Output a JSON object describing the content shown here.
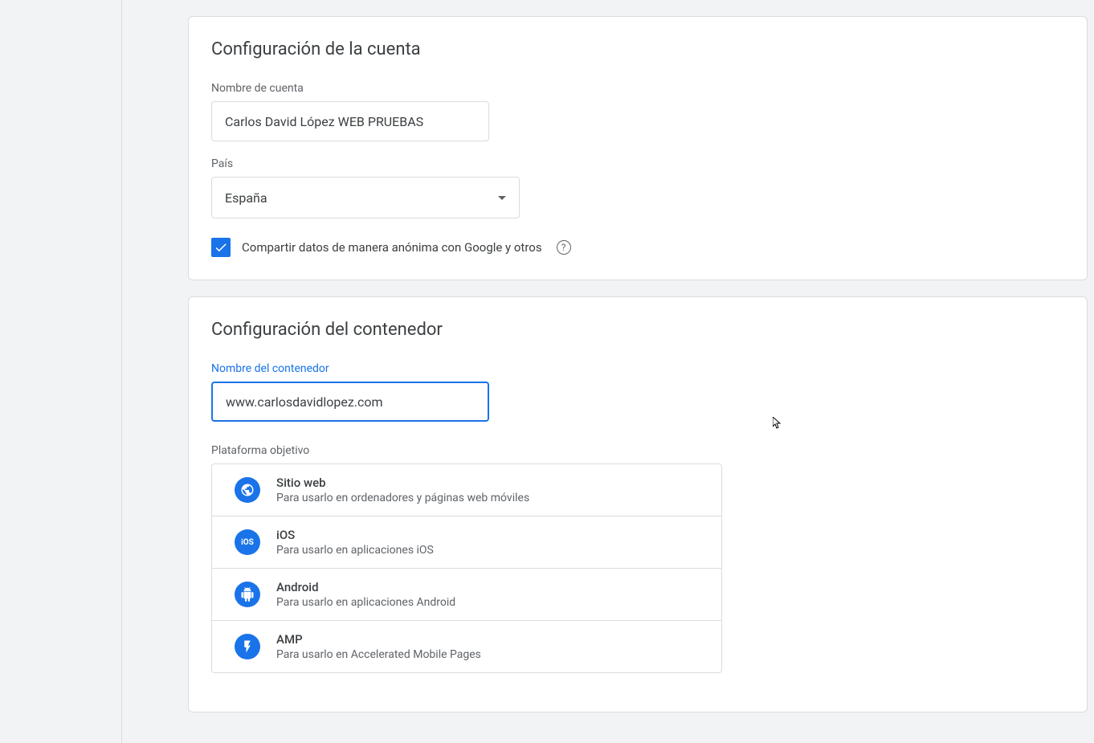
{
  "account_section": {
    "title": "Configuración de la cuenta",
    "account_name_label": "Nombre de cuenta",
    "account_name_value": "Carlos David López WEB PRUEBAS",
    "country_label": "País",
    "country_value": "España",
    "share_checkbox_label": "Compartir datos de manera anónima con Google y otros",
    "share_checked": true
  },
  "container_section": {
    "title": "Configuración del contenedor",
    "container_name_label": "Nombre del contenedor",
    "container_name_value": "www.carlosdavidlopez.com",
    "platform_label": "Plataforma objetivo",
    "platforms": [
      {
        "id": "web",
        "title": "Sitio web",
        "desc": "Para usarlo en ordenadores y páginas web móviles"
      },
      {
        "id": "ios",
        "title": "iOS",
        "desc": "Para usarlo en aplicaciones iOS"
      },
      {
        "id": "android",
        "title": "Android",
        "desc": "Para usarlo en aplicaciones Android"
      },
      {
        "id": "amp",
        "title": "AMP",
        "desc": "Para usarlo en Accelerated Mobile Pages"
      }
    ]
  }
}
